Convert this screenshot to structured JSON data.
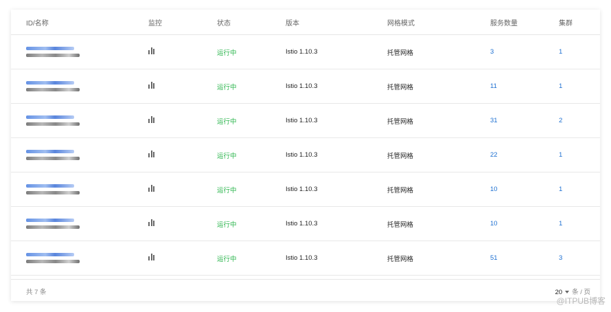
{
  "table": {
    "headers": [
      "ID/名称",
      "监控",
      "状态",
      "版本",
      "网格模式",
      "服务数量",
      "集群"
    ],
    "rows": [
      {
        "status": "运行中",
        "version": "Istio 1.10.3",
        "mode": "托管网格",
        "services": "3",
        "clusters": "1"
      },
      {
        "status": "运行中",
        "version": "Istio 1.10.3",
        "mode": "托管网格",
        "services": "11",
        "clusters": "1"
      },
      {
        "status": "运行中",
        "version": "Istio 1.10.3",
        "mode": "托管网格",
        "services": "31",
        "clusters": "2"
      },
      {
        "status": "运行中",
        "version": "Istio 1.10.3",
        "mode": "托管网格",
        "services": "22",
        "clusters": "1"
      },
      {
        "status": "运行中",
        "version": "Istio 1.10.3",
        "mode": "托管网格",
        "services": "10",
        "clusters": "1"
      },
      {
        "status": "运行中",
        "version": "Istio 1.10.3",
        "mode": "托管网格",
        "services": "10",
        "clusters": "1"
      },
      {
        "status": "运行中",
        "version": "Istio 1.10.3",
        "mode": "托管网格",
        "services": "51",
        "clusters": "3"
      }
    ]
  },
  "footer": {
    "total": "共 7 条",
    "page_size": "20",
    "page_unit": "条 / 页"
  },
  "watermark": "@ITPUB博客",
  "colors": {
    "status_running": "#2eb64f",
    "link": "#1c6fd1"
  },
  "icons": {
    "monitor": "bar-chart-icon",
    "page_size": "chevron-down-icon"
  }
}
